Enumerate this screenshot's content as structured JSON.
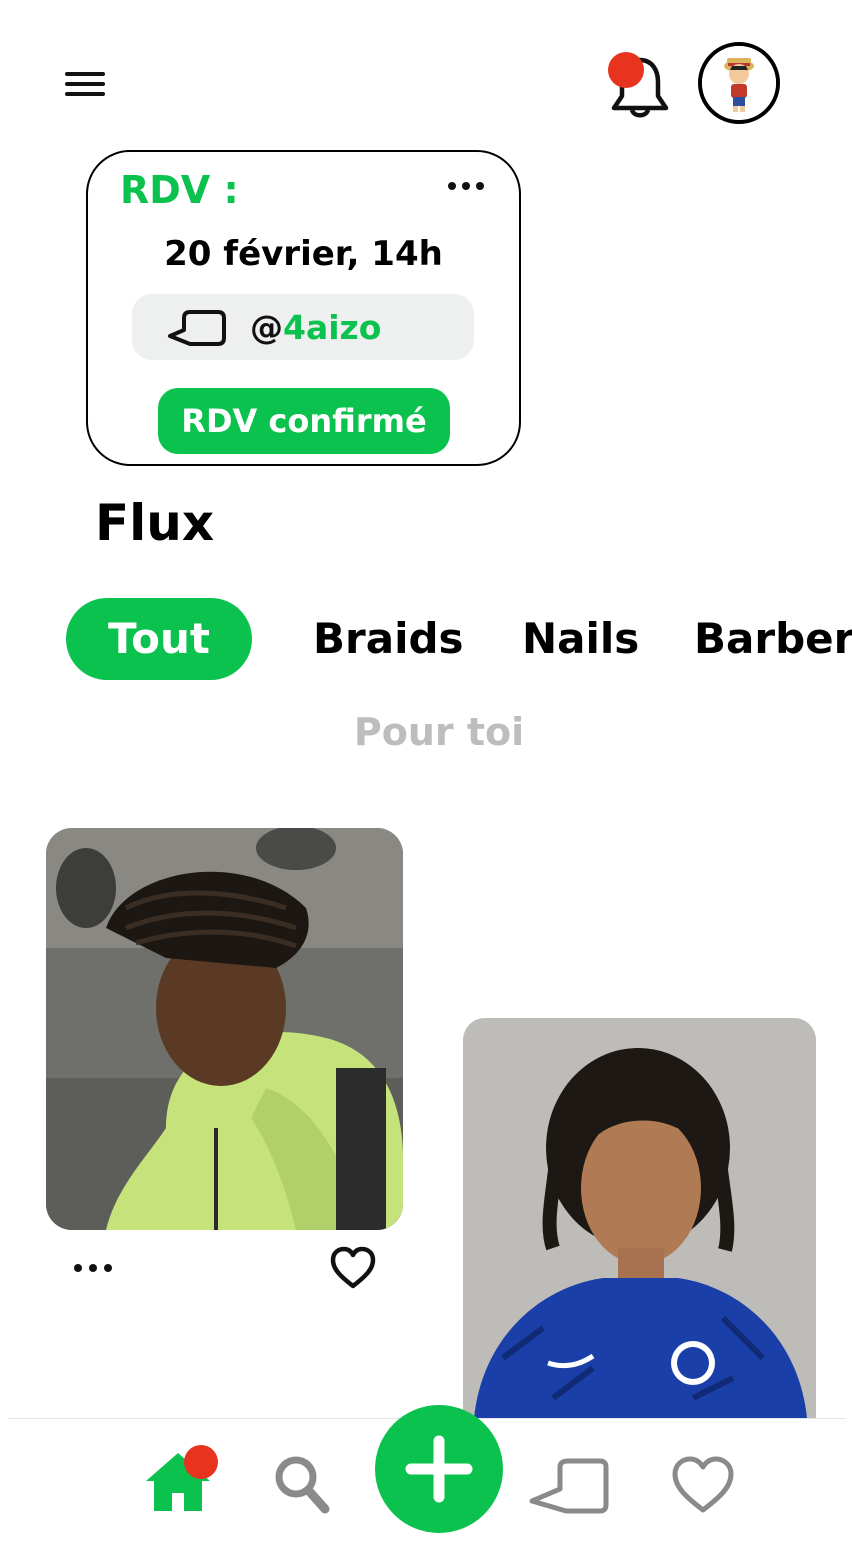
{
  "header": {
    "menu_icon": "hamburger-menu-icon",
    "bell_icon": "bell-icon",
    "has_notification": true,
    "avatar": "user-avatar"
  },
  "appointment": {
    "title": "RDV :",
    "date": "20 février, 14h",
    "handle_prefix": "@",
    "handle_name": "4aizo",
    "status": "RDV confirmé"
  },
  "feed": {
    "title": "Flux",
    "tabs": [
      "Tout",
      "Braids",
      "Nails",
      "Barber"
    ],
    "active_tab": "Tout",
    "section_label": "Pour toi"
  },
  "nav": {
    "items": [
      "home-icon",
      "search-icon",
      "plus-icon",
      "chat-bubble-icon",
      "heart-icon"
    ],
    "home_has_badge": true
  },
  "colors": {
    "accent": "#0cc24e",
    "notification": "#e8331f",
    "muted": "#bdbdbd",
    "nav_icon": "#8a8a8a"
  }
}
